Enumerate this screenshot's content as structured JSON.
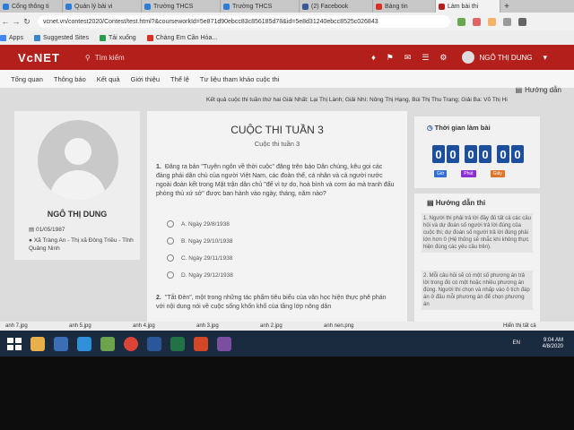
{
  "browser": {
    "tabs": [
      {
        "label": "Cổng thông ti",
        "active": false,
        "color": "#2d7cd6"
      },
      {
        "label": "Quản lý bài vi",
        "active": false,
        "color": "#2d7cd6"
      },
      {
        "label": "Trường THCS",
        "active": false,
        "color": "#2d7cd6"
      },
      {
        "label": "Trường THCS",
        "active": false,
        "color": "#2d7cd6"
      },
      {
        "label": "(2) Facebook",
        "active": false,
        "color": "#3b5998"
      },
      {
        "label": "Bảng tin",
        "active": false,
        "color": "#d93025"
      },
      {
        "label": "Làm bài thi",
        "active": true,
        "color": "#b3201c"
      }
    ],
    "new_tab": "+",
    "url": "vcnet.vn/contest2020/Contest/test.html?&courseworkId=5e871d90ebcc83c856185d78&id=5e8d31240ebcc8525c026843",
    "bookmarks": [
      {
        "label": "Apps",
        "color": "#4285f4"
      },
      {
        "label": "Suggested Sites",
        "color": "#3a86c6"
      },
      {
        "label": "Tải xuống",
        "color": "#2a9d4a"
      },
      {
        "label": "Chàng Em Cần Hóa...",
        "color": "#d93025"
      }
    ]
  },
  "site": {
    "logo": "VcNET",
    "search_placeholder": "Tìm kiếm",
    "user_name": "NGÔ THỊ DUNG",
    "menu": [
      "Tổng quan",
      "Thông báo",
      "Kết quả",
      "Giới thiệu",
      "Thể lệ",
      "Tư liệu tham khảo cuộc thi"
    ],
    "guide_link": "Hướng dẫn",
    "ticker": "Kết quả cuộc thi tuần thứ hai Giải Nhất: Lại Thị Lành; Giải Nhì: Nông Thị Hạng, Bùi Thị Thu Trang; Giải Ba: Võ Thị Hi"
  },
  "profile": {
    "name": "NGÔ THỊ DUNG",
    "dob": "01/05/1987",
    "address": "Xã Tràng An - Thị xã Đông Triều - Tỉnh Quảng Ninh"
  },
  "contest": {
    "title": "CUỘC THI TUẦN 3",
    "subtitle": "Cuộc thi tuần 3",
    "q1_num": "1.",
    "q1_text": "Đăng ra bản \"Tuyên ngôn về thời cuộc\" đăng trên báo Dân chúng, kêu gọi các đảng phái dân chủ của người Việt Nam, các đoàn thể, cá nhân và cả người nước ngoài đoàn kết trong Mặt trận dân chủ \"để vì tự do, hoà bình và cơm áo mà tranh đấu phòng thủ xứ sở\" được ban hành vào ngày, tháng, năm nào?",
    "options": [
      "A. Ngày 29/8/1938",
      "B. Ngày 29/10/1938",
      "C. Ngày 29/11/1938",
      "D. Ngày 29/12/1938"
    ],
    "q2_num": "2.",
    "q2_text": "\"Tắt Đèn\", một trong những tác phẩm tiêu biểu của văn học hiện thực phê phán với nội dung nói về cuộc sống khốn khổ của tầng lớp nông dân"
  },
  "timer": {
    "label": "Thời gian làm bài",
    "digits": [
      "0",
      "0",
      "0",
      "0",
      "0",
      "0"
    ],
    "units": [
      {
        "label": "Giờ",
        "color": "#2f6fd6"
      },
      {
        "label": "Phút",
        "color": "#8e2fd6"
      },
      {
        "label": "Giây",
        "color": "#e0742a"
      }
    ]
  },
  "guide": {
    "title": "Hướng dẫn thi",
    "item1": "1. Người thi phải trả lời đầy đủ tất cả các câu hỏi và dự đoán số người trả lời đúng của cuộc thi; dự đoán số người trả lời đúng phải lớn hơn 0 (Hệ thống sẽ nhắc khi không thực hiện đúng các yêu cầu trên).",
    "item2": "2. Mỗi câu hỏi sẽ có một số phương án trả lời trong đó có một hoặc nhiều phương án đúng. Người thi chọn và nhấp vào ô tích đáp án ở đầu mỗi phương án để chọn phương án"
  },
  "downloads": {
    "items": [
      "anh 7.jpg",
      "anh 5.jpg",
      "anh 4.jpg",
      "anh 3.jpg",
      "anh 2.jpg",
      "anh nen.png"
    ],
    "show_all": "Hiển thị tất cả"
  },
  "taskbar": {
    "lang": "EN",
    "time": "9:04 AM",
    "date": "4/8/2020",
    "apps": [
      {
        "name": "explorer",
        "color": "#e8b04a"
      },
      {
        "name": "mail",
        "color": "#3a6fb5"
      },
      {
        "name": "ie",
        "color": "#2f8fd8"
      },
      {
        "name": "photos",
        "color": "#6da34d"
      },
      {
        "name": "chrome",
        "color": "#db4437"
      },
      {
        "name": "word",
        "color": "#2b579a"
      },
      {
        "name": "excel",
        "color": "#217346"
      },
      {
        "name": "powerpoint",
        "color": "#d24726"
      },
      {
        "name": "media",
        "color": "#7a4fa0"
      }
    ]
  }
}
